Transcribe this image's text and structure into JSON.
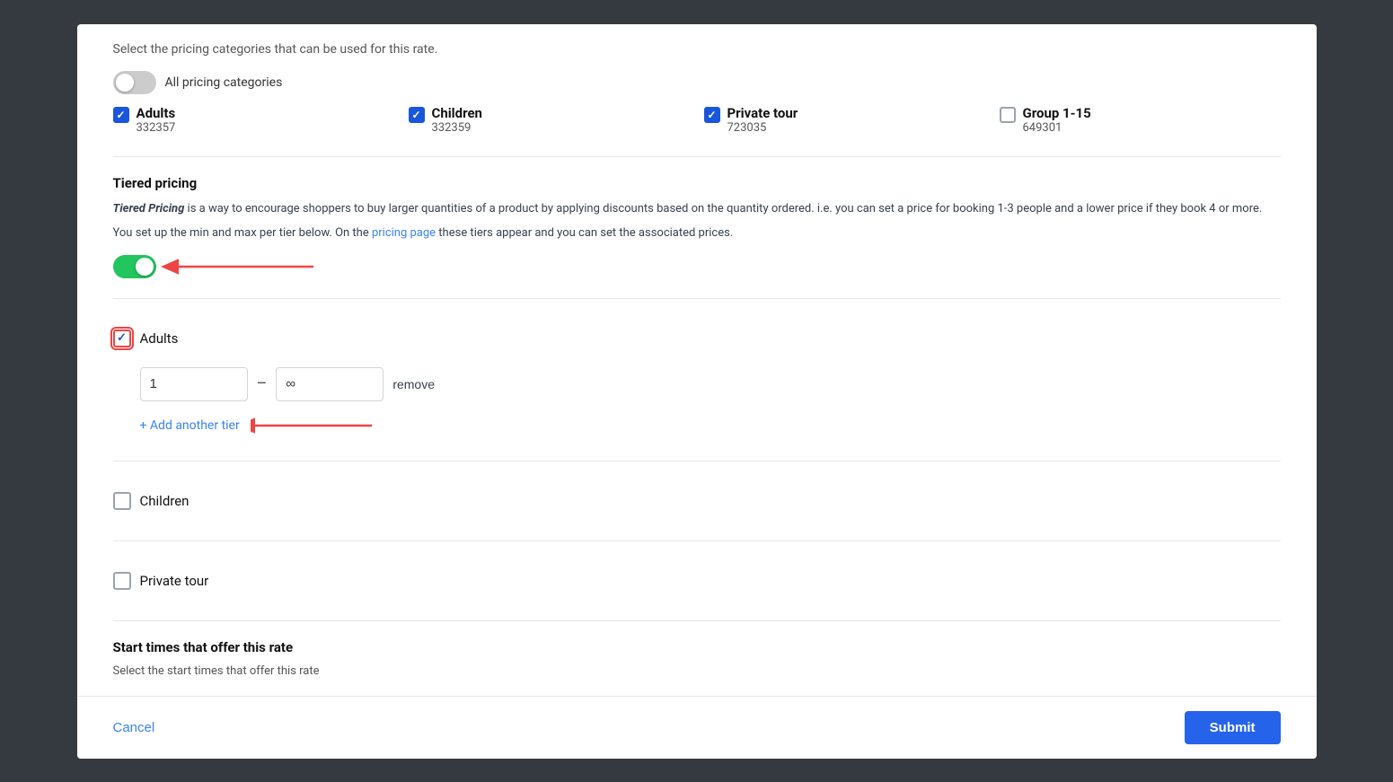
{
  "modal": {
    "description": "Select the pricing categories that can be used for this rate.",
    "toggle_all_label": "All pricing categories",
    "categories": [
      {
        "name": "Adults",
        "id": "332357",
        "checked": true
      },
      {
        "name": "Children",
        "id": "332359",
        "checked": true
      },
      {
        "name": "Private tour",
        "id": "723035",
        "checked": true
      },
      {
        "name": "Group 1-15",
        "id": "649301",
        "checked": false
      }
    ],
    "tiered_pricing": {
      "title": "Tiered pricing",
      "description_part1": "Tiered Pricing",
      "description_part2": " is a way to encourage shoppers to buy larger quantities of a product by applying discounts based on the quantity ordered. i.e. you can set a price for booking 1-3 people and a lower price if they book 4 or more.",
      "description_line2": "You set up the min and max per tier below. On the ",
      "pricing_page_link": "pricing page",
      "description_line2_end": " these tiers appear and you can set the associated prices.",
      "toggle_on": true,
      "tiers": [
        {
          "category": "Adults",
          "checked": true,
          "rows": [
            {
              "min": "1",
              "max": "∞"
            }
          ]
        },
        {
          "category": "Children",
          "checked": false,
          "rows": []
        },
        {
          "category": "Private tour",
          "checked": false,
          "rows": []
        }
      ],
      "add_tier_label": "+ Add another tier",
      "remove_label": "remove"
    },
    "start_times": {
      "title": "Start times that offer this rate",
      "description": "Select the start times that offer this rate"
    },
    "footer": {
      "cancel_label": "Cancel",
      "submit_label": "Submit"
    }
  }
}
